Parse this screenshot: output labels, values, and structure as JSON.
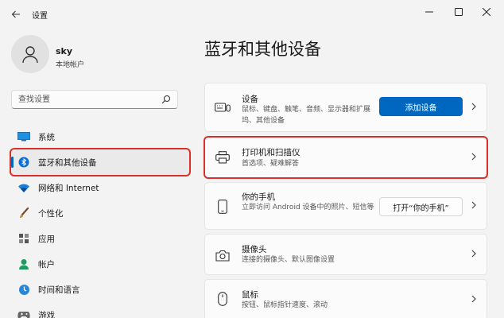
{
  "window": {
    "title": "设置"
  },
  "user": {
    "name": "sky",
    "account_type": "本地帐户"
  },
  "search": {
    "placeholder": "查找设置"
  },
  "nav": {
    "items": [
      {
        "label": "系统",
        "icon": "monitor-icon",
        "active": false
      },
      {
        "label": "蓝牙和其他设备",
        "icon": "bluetooth-icon",
        "active": true
      },
      {
        "label": "网络和 Internet",
        "icon": "wifi-icon",
        "active": false
      },
      {
        "label": "个性化",
        "icon": "brush-icon",
        "active": false
      },
      {
        "label": "应用",
        "icon": "apps-icon",
        "active": false
      },
      {
        "label": "帐户",
        "icon": "person-icon",
        "active": false
      },
      {
        "label": "时间和语言",
        "icon": "globe-clock-icon",
        "active": false
      },
      {
        "label": "游戏",
        "icon": "gamepad-icon",
        "active": false
      }
    ]
  },
  "main": {
    "title": "蓝牙和其他设备",
    "cards": {
      "devices": {
        "title": "设备",
        "desc": "鼠标、键盘、触笔、音频、显示器和扩展坞、其他设备",
        "button": "添加设备"
      },
      "printers": {
        "title": "打印机和扫描仪",
        "desc": "首选项、疑难解答"
      },
      "phone": {
        "title": "你的手机",
        "desc": "立即访问 Android 设备中的照片、短信等",
        "button": "打开“你的手机”"
      },
      "camera": {
        "title": "摄像头",
        "desc": "连接的摄像头、默认图像设置"
      },
      "mouse": {
        "title": "鼠标",
        "desc": "按钮、鼠标指针速度、滚动"
      }
    }
  },
  "colors": {
    "accent": "#0067c0",
    "highlight": "#d9302c"
  }
}
